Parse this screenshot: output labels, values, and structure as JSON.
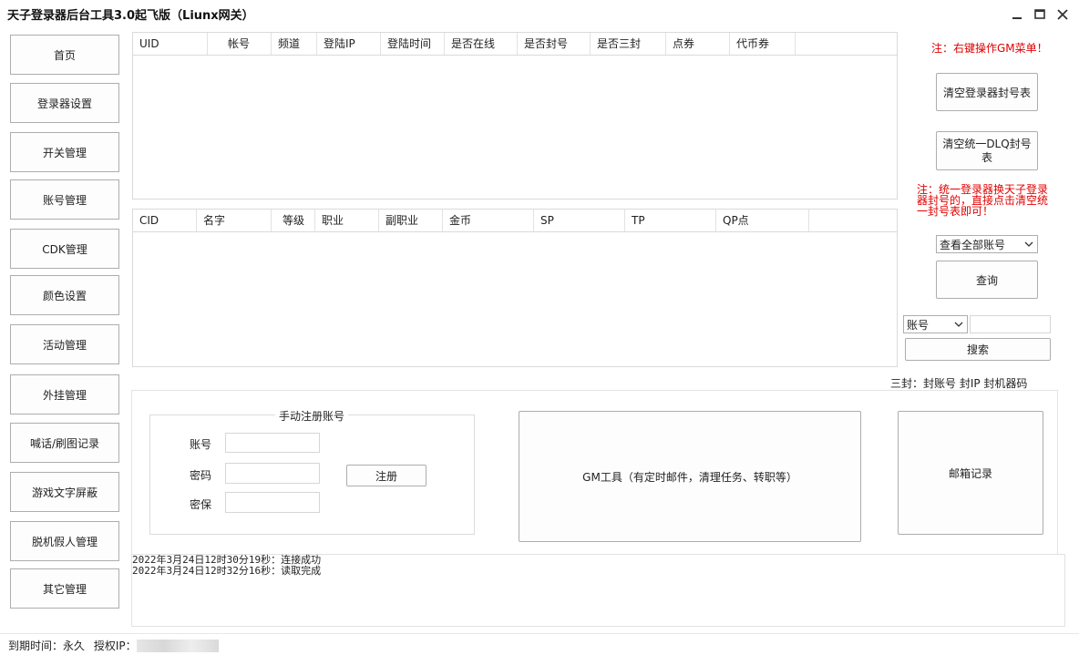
{
  "window": {
    "title": "天子登录器后台工具3.0起飞版（Liunx网关）"
  },
  "nav": [
    "首页",
    "登录器设置",
    "开关管理",
    "账号管理",
    "CDK管理",
    "颜色设置",
    "活动管理",
    "外挂管理",
    "喊话/刷图记录",
    "游戏文字屏蔽",
    "脱机假人管理",
    "其它管理"
  ],
  "account_table": {
    "columns": [
      "UID",
      "帐号",
      "频道",
      "登陆IP",
      "登陆时间",
      "是否在线",
      "是否封号",
      "是否三封",
      "点券",
      "代币券"
    ]
  },
  "char_table": {
    "columns": [
      "CID",
      "名字",
      "等级",
      "职业",
      "副职业",
      "金币",
      "SP",
      "TP",
      "QP点"
    ]
  },
  "right": {
    "note_gm": "注：右键操作GM菜单！",
    "clear_ban_label": "清空登录器封号表",
    "clear_dlq_label": "清空统一DLQ封号表",
    "note_dlq": "注：统一登录器换天子登录器封号的，直接点击清空统一封号表即可！",
    "view_select": "查看全部账号",
    "query_label": "查询",
    "search_field_select": "账号",
    "search_value": "",
    "search_label": "搜索",
    "three_ban_note": "三封：封账号 封IP 封机器码"
  },
  "register": {
    "group_title": "手动注册账号",
    "account_label": "账号",
    "password_label": "密码",
    "secret_label": "密保",
    "account_value": "",
    "password_value": "",
    "secret_value": "",
    "submit_label": "注册"
  },
  "tools": {
    "gm_label": "GM工具（有定时邮件，清理任务、转职等）",
    "mail_label": "邮箱记录"
  },
  "log": {
    "lines": [
      "2022年3月24日12时30分19秒：连接成功",
      "2022年3月24日12时32分16秒：读取完成"
    ]
  },
  "status": {
    "expire_label": "到期时间：",
    "expire_value": "永久",
    "ip_label": "授权IP："
  }
}
